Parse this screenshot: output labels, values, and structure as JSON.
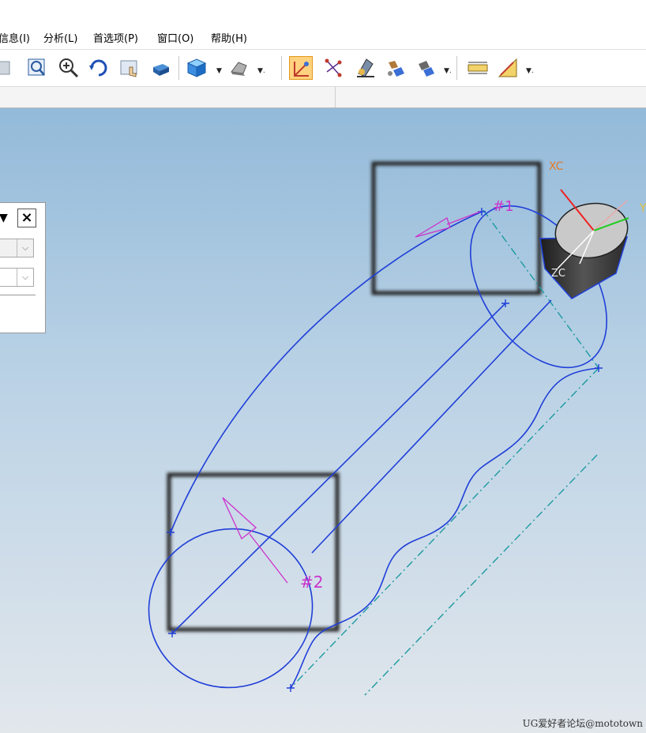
{
  "menu": {
    "items": [
      "信息(I)",
      "分析(L)",
      "首选项(P)",
      "窗口(O)",
      "帮助(H)"
    ]
  },
  "toolbar": {
    "icons": [
      "fit-icon",
      "zoom-window-icon",
      "zoom-icon",
      "rotate-icon",
      "pan-icon",
      "render-style-icon",
      "view-cube-icon",
      "shaded-dropdown-icon",
      "select-curve-icon",
      "point-icon",
      "snap-icon",
      "feature-icon",
      "feature-dropdown-icon",
      "measure-distance-icon",
      "measure-angle-icon"
    ]
  },
  "viewport": {
    "label_1": "#1",
    "label_2": "#2",
    "axis_x": "XC",
    "axis_z": "ZC",
    "axis_y": "Y"
  },
  "watermark": "UG爱好者论坛@mototown",
  "colors": {
    "curve": "#1f3fd8",
    "dashed": "#1c9aa0",
    "magenta": "#cc33cc",
    "axis_label": "#e07a2a",
    "viewport_top": "#93bad9",
    "viewport_bottom": "#e2e7ec"
  }
}
